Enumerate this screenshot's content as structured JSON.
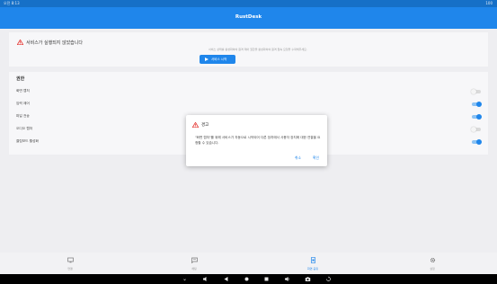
{
  "status_bar": {
    "time": "오전 8:13",
    "battery": "100"
  },
  "app_bar": {
    "title": "RustDesk"
  },
  "warning_card": {
    "title": "서비스가 실행되지 않았습니다",
    "description": "서비스 상태를 활성화하여 원격 제어 권한을 활성화하여 원격 접속 요청을 수락해주세요.",
    "start_button": "서비스 시작"
  },
  "permissions": {
    "title": "권한",
    "items": [
      {
        "label": "화면 캡처",
        "enabled": false
      },
      {
        "label": "입력 제어",
        "enabled": true
      },
      {
        "label": "파일 전송",
        "enabled": true
      },
      {
        "label": "오디오 캡처",
        "enabled": false
      },
      {
        "label": "클립보드 활성화",
        "enabled": true
      }
    ]
  },
  "dialog": {
    "title": "경고",
    "message": "\"화면 캡처\"를 위해 서비스가 자동으로 시작되어 다른 장치에서 사용자 장치에 대한 연결을 요청할 수 있습니다.",
    "cancel": "취소",
    "confirm": "확인"
  },
  "bottom_nav": [
    {
      "label": "연결",
      "icon": "monitor-icon",
      "active": false
    },
    {
      "label": "채팅",
      "icon": "chat-icon",
      "active": false
    },
    {
      "label": "화면 공유",
      "icon": "phone-share-icon",
      "active": true
    },
    {
      "label": "설정",
      "icon": "gear-icon",
      "active": false
    }
  ],
  "colors": {
    "primary": "#1f86eb",
    "warning": "#e53935",
    "background": "#eeeef1"
  }
}
